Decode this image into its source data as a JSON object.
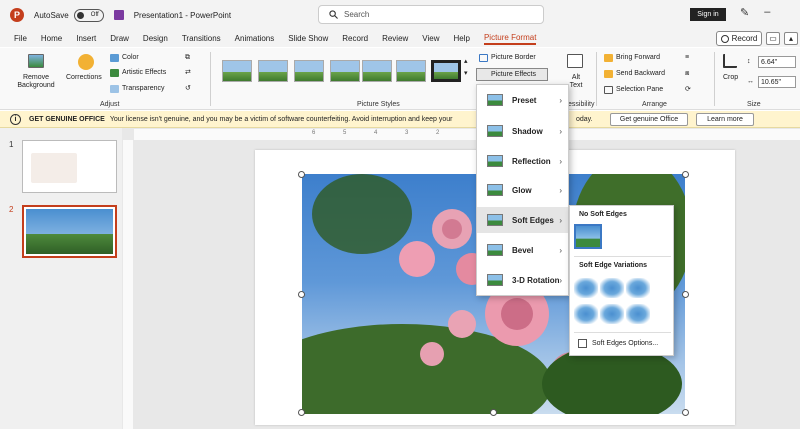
{
  "titlebar": {
    "autosave_label": "AutoSave",
    "autosave_state": "Off",
    "doc_title": "Presentation1 - PowerPoint",
    "search_placeholder": "Search",
    "signin_label": "Sign in"
  },
  "menu": [
    "File",
    "Home",
    "Insert",
    "Draw",
    "Design",
    "Transitions",
    "Animations",
    "Slide Show",
    "Record",
    "Review",
    "View",
    "Help",
    "Picture Format"
  ],
  "record_label": "Record",
  "ribbon": {
    "remove_background": "Remove Background",
    "corrections": "Corrections",
    "color": "Color",
    "artistic_effects": "Artistic Effects",
    "transparency": "Transparency",
    "adjust": "Adjust",
    "picture_styles": "Picture Styles",
    "picture_border": "Picture Border",
    "picture_effects": "Picture Effects",
    "alt_text": "Alt Text",
    "accessibility": "essibility",
    "bring_forward": "Bring Forward",
    "send_backward": "Send Backward",
    "selection_pane": "Selection Pane",
    "arrange": "Arrange",
    "crop": "Crop",
    "height": "6.64\"",
    "width": "10.65\"",
    "size": "Size"
  },
  "notice": {
    "title": "GET GENUINE OFFICE",
    "message": "Your license isn't genuine, and you may be a victim of software counterfeiting. Avoid interruption and keep your",
    "tail": "oday.",
    "btn_genuine": "Get genuine Office",
    "btn_learn": "Learn more"
  },
  "slides": [
    "1",
    "2"
  ],
  "ruler_ticks": [
    "6",
    "5",
    "4",
    "3",
    "2",
    "1",
    "0",
    "1",
    "2",
    "3",
    "4",
    "5",
    "6"
  ],
  "effects_menu": [
    {
      "label": "Preset"
    },
    {
      "label": "Shadow"
    },
    {
      "label": "Reflection"
    },
    {
      "label": "Glow"
    },
    {
      "label": "Soft Edges"
    },
    {
      "label": "Bevel"
    },
    {
      "label": "3-D Rotation"
    }
  ],
  "soft_edges": {
    "no_soft_edges": "No Soft Edges",
    "variations": "Soft Edge Variations",
    "options": "Soft Edges Options..."
  }
}
